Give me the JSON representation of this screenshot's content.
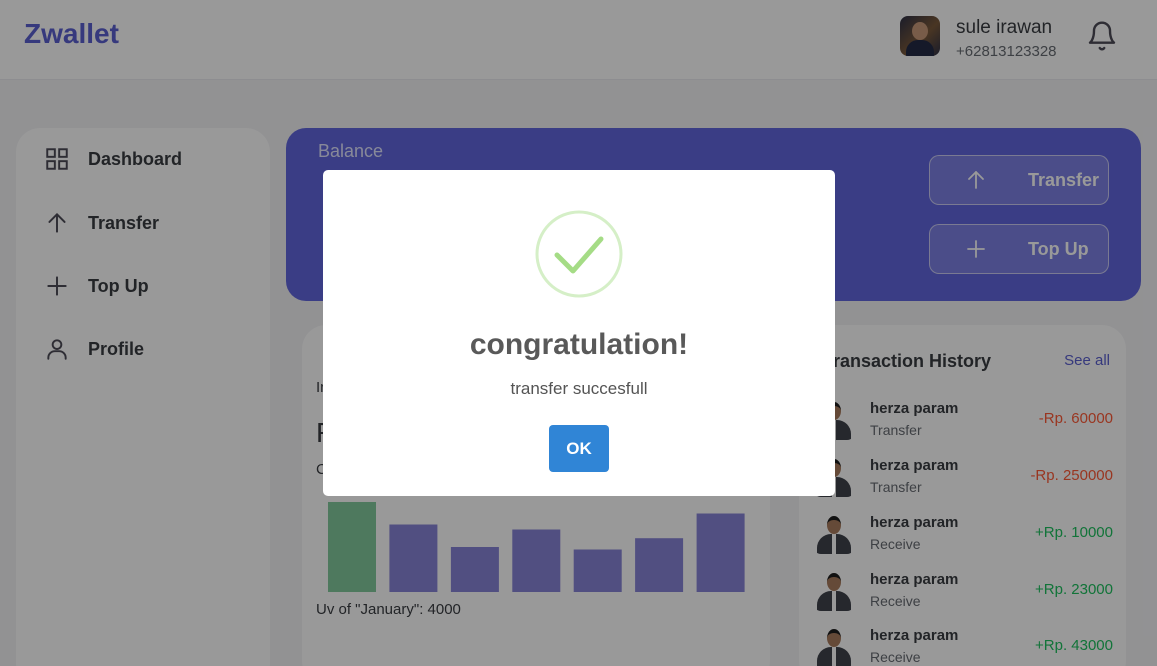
{
  "app": {
    "logo": "Zwallet"
  },
  "user": {
    "name": "sule irawan",
    "phone": "+62813123328"
  },
  "sidebar": {
    "items": [
      {
        "label": "Dashboard",
        "icon": "grid-icon"
      },
      {
        "label": "Transfer",
        "icon": "arrow-up-icon"
      },
      {
        "label": "Top Up",
        "icon": "plus-icon"
      },
      {
        "label": "Profile",
        "icon": "user-icon"
      }
    ]
  },
  "balance": {
    "label": "Balance",
    "transfer_label": "Transfer",
    "topup_label": "Top Up"
  },
  "chart": {
    "income_label": "In",
    "title_initial": "R",
    "sub_initial": "C",
    "tooltip": "Uv of \"January\": 4000"
  },
  "chart_data": {
    "type": "bar",
    "categories": [
      "January",
      "",
      "",
      "",
      "",
      "",
      ""
    ],
    "values": [
      4000,
      3000,
      2000,
      2780,
      1890,
      2390,
      3490
    ],
    "highlighted_index": 0,
    "colors": {
      "highlight": "#82ca9d",
      "default": "#8884d8"
    }
  },
  "history": {
    "title": "Transaction History",
    "see_all": "See all",
    "items": [
      {
        "name": "herza param",
        "type": "Transfer",
        "amount": "-Rp. 60000",
        "direction": "out"
      },
      {
        "name": "herza param",
        "type": "Transfer",
        "amount": "-Rp. 250000",
        "direction": "out"
      },
      {
        "name": "herza param",
        "type": "Receive",
        "amount": "+Rp. 10000",
        "direction": "in"
      },
      {
        "name": "herza param",
        "type": "Receive",
        "amount": "+Rp. 23000",
        "direction": "in"
      },
      {
        "name": "herza param",
        "type": "Receive",
        "amount": "+Rp. 43000",
        "direction": "in"
      }
    ]
  },
  "modal": {
    "title": "congratulation!",
    "text": "transfer succesfull",
    "ok_label": "OK",
    "icon": "success-check-icon"
  }
}
